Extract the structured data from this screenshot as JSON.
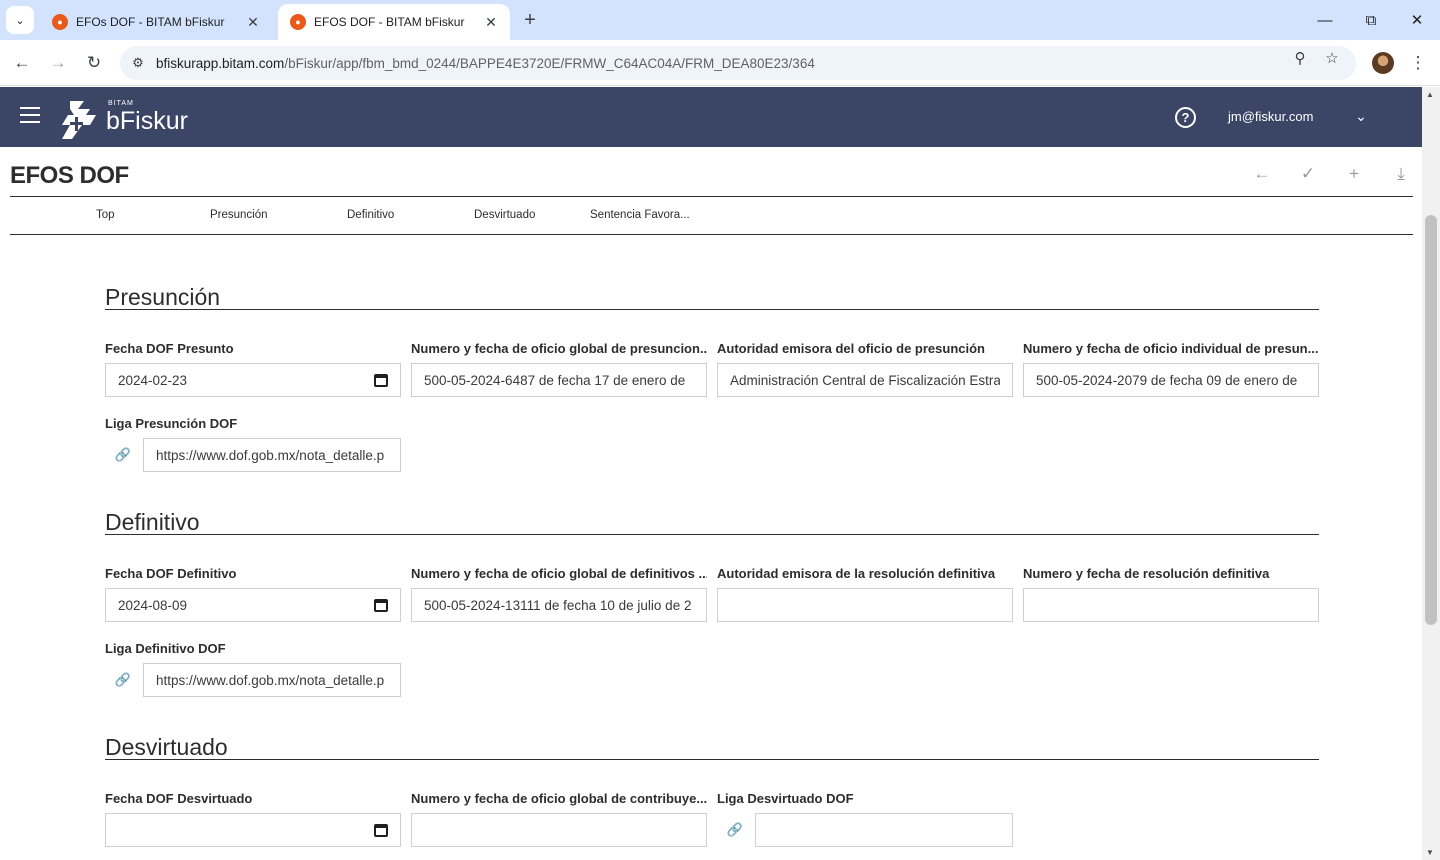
{
  "browser": {
    "tabs": [
      {
        "title": "EFOs DOF - BITAM bFiskur",
        "active": false
      },
      {
        "title": "EFOS DOF - BITAM bFiskur",
        "active": true
      }
    ],
    "url_host": "bfiskurapp.bitam.com",
    "url_path": "/bFiskur/app/fbm_bmd_0244/BAPPE4E3720E/FRMW_C64AC04A/FRM_DEA80E23/364"
  },
  "app": {
    "logo_small": "BITAM",
    "logo_text": "bFiskur",
    "user_email": "jm@fiskur.com",
    "header_color": "#3b4566"
  },
  "form": {
    "title": "EFOS DOF",
    "subnav": [
      "Top",
      "Presunción",
      "Definitivo",
      "Desvirtuado",
      "Sentencia Favora..."
    ]
  },
  "sections": {
    "presuncion": {
      "title": "Presunción",
      "fields": [
        {
          "label": "Fecha DOF Presunto",
          "value": "2024-02-23"
        },
        {
          "label": "Numero y fecha de oficio global de presuncion...",
          "value": "500-05-2024-6487 de fecha 17 de enero de"
        },
        {
          "label": "Autoridad emisora del oficio de presunción",
          "value": "Administración Central de Fiscalización Estra"
        },
        {
          "label": "Numero y fecha de oficio individual de presun...",
          "value": "500-05-2024-2079 de fecha 09 de enero de"
        }
      ],
      "link": {
        "label": "Liga Presunción DOF",
        "value": "https://www.dof.gob.mx/nota_detalle.p"
      }
    },
    "definitivo": {
      "title": "Definitivo",
      "fields": [
        {
          "label": "Fecha DOF Definitivo",
          "value": "2024-08-09"
        },
        {
          "label": "Numero y fecha de oficio global de definitivos ...",
          "value": "500-05-2024-13111 de fecha 10 de julio de 2"
        },
        {
          "label": "Autoridad emisora de la resolución definitiva",
          "value": ""
        },
        {
          "label": "Numero y fecha de resolución definitiva",
          "value": ""
        }
      ],
      "link": {
        "label": "Liga Definitivo DOF",
        "value": "https://www.dof.gob.mx/nota_detalle.p"
      }
    },
    "desvirtuado": {
      "title": "Desvirtuado",
      "fields": [
        {
          "label": "Fecha DOF Desvirtuado",
          "value": ""
        },
        {
          "label": "Numero y fecha de oficio global de contribuye...",
          "value": ""
        }
      ],
      "link": {
        "label": "Liga Desvirtuado DOF",
        "value": ""
      }
    }
  }
}
